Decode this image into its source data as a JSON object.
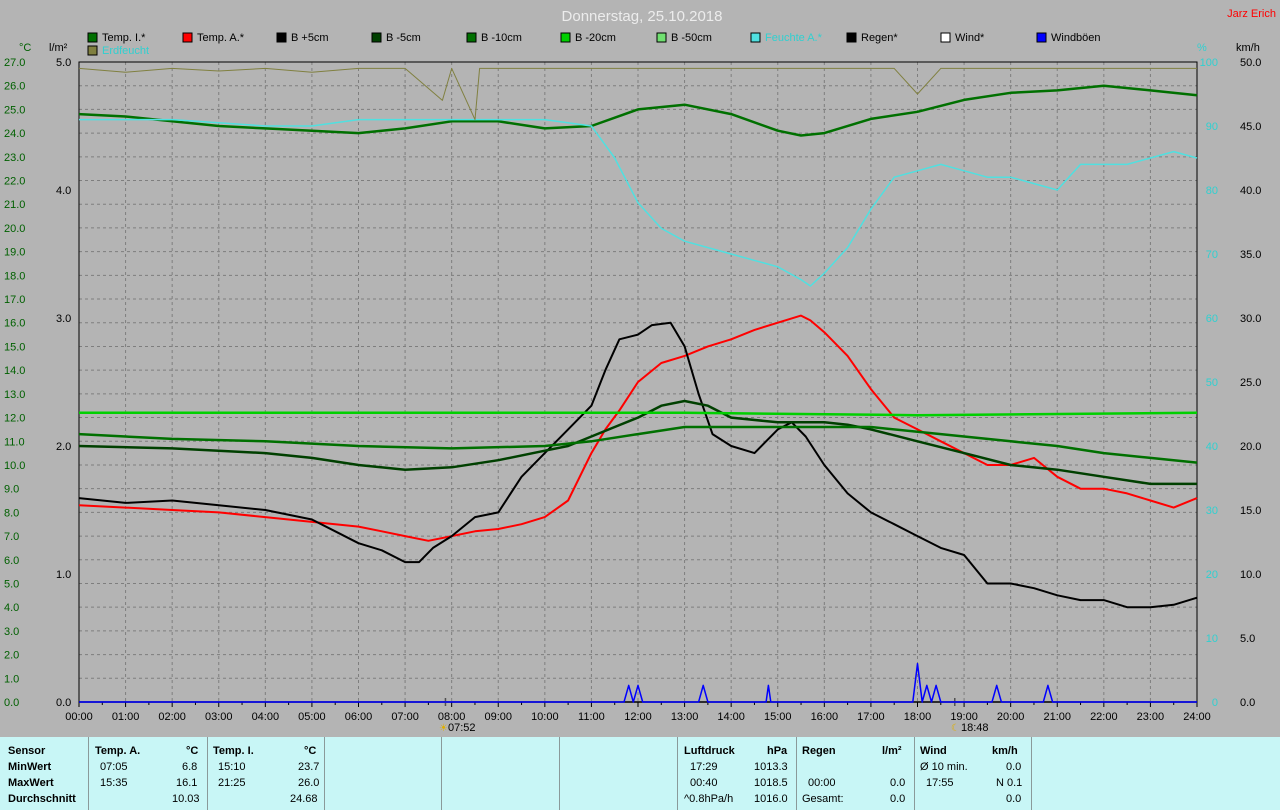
{
  "chart_data": {
    "type": "line",
    "title": "Donnerstag, 25.10.2018",
    "author": "Jarz Erich",
    "x_ticks": [
      "00:00",
      "01:00",
      "02:00",
      "03:00",
      "04:00",
      "05:00",
      "06:00",
      "07:00",
      "08:00",
      "09:00",
      "10:00",
      "11:00",
      "12:00",
      "13:00",
      "14:00",
      "15:00",
      "16:00",
      "17:00",
      "18:00",
      "19:00",
      "20:00",
      "21:00",
      "22:00",
      "23:00",
      "24:00"
    ],
    "axes": {
      "temp": {
        "unit": "°C",
        "range": [
          0,
          27
        ],
        "ticks": [
          0.0,
          1.0,
          2.0,
          3.0,
          4.0,
          5.0,
          6.0,
          7.0,
          8.0,
          9.0,
          10.0,
          11.0,
          12.0,
          13.0,
          14.0,
          15.0,
          16.0,
          17.0,
          18.0,
          19.0,
          20.0,
          21.0,
          22.0,
          23.0,
          24.0,
          25.0,
          26.0,
          27.0
        ]
      },
      "rain": {
        "unit": "l/m²",
        "range": [
          0,
          5
        ],
        "ticks": [
          0.0,
          1.0,
          2.0,
          3.0,
          4.0,
          5.0
        ]
      },
      "humidity": {
        "unit": "%",
        "range": [
          0,
          100
        ],
        "ticks": [
          0,
          10,
          20,
          30,
          40,
          50,
          60,
          70,
          80,
          90,
          100
        ]
      },
      "wind": {
        "unit": "km/h",
        "range": [
          0,
          50
        ],
        "ticks": [
          0.0,
          5.0,
          10.0,
          15.0,
          20.0,
          25.0,
          30.0,
          35.0,
          40.0,
          45.0,
          50.0
        ]
      }
    },
    "legend": [
      {
        "name": "Temp. I.*",
        "color": "#007000"
      },
      {
        "name": "Temp. A.*",
        "color": "#ff0000"
      },
      {
        "name": "B +5cm",
        "color": "#000000"
      },
      {
        "name": "B -5cm",
        "color": "#004000"
      },
      {
        "name": "B -10cm",
        "color": "#007000"
      },
      {
        "name": "B -20cm",
        "color": "#00d000"
      },
      {
        "name": "B -50cm",
        "color": "#70e070"
      },
      {
        "name": "Feuchte A.*",
        "color": "#50e0e0"
      },
      {
        "name": "Regen*",
        "color": "#000000"
      },
      {
        "name": "Wind*",
        "color": "#ffffff"
      },
      {
        "name": "Windböen",
        "color": "#0000ff"
      },
      {
        "name": "Erdfeucht",
        "color": "#808040"
      }
    ],
    "sunrise": "07:52",
    "sunset": "18:48",
    "series": [
      {
        "name": "Temp. I.*",
        "axis": "temp",
        "color": "#007000",
        "x": [
          0,
          1,
          2,
          3,
          4,
          5,
          6,
          6.5,
          7,
          8,
          9,
          10,
          11,
          12,
          13,
          14,
          15,
          15.5,
          16,
          17,
          18,
          19,
          20,
          21,
          22,
          23,
          24
        ],
        "y": [
          24.8,
          24.7,
          24.5,
          24.3,
          24.2,
          24.1,
          24.0,
          24.1,
          24.2,
          24.5,
          24.5,
          24.2,
          24.3,
          25.0,
          25.2,
          24.8,
          24.1,
          23.9,
          24.0,
          24.6,
          24.9,
          25.4,
          25.7,
          25.8,
          26.0,
          25.8,
          25.6
        ]
      },
      {
        "name": "Temp. A.*",
        "axis": "temp",
        "color": "#ff0000",
        "x": [
          0,
          1,
          2,
          3,
          4,
          5,
          6,
          6.5,
          7,
          7.5,
          8,
          8.5,
          9,
          9.5,
          10,
          10.5,
          11,
          11.3,
          11.6,
          12,
          12.5,
          13,
          13.5,
          14,
          14.5,
          15,
          15.5,
          15.7,
          16,
          16.5,
          17,
          17.5,
          18,
          18.5,
          19,
          19.5,
          20,
          20.5,
          21,
          21.5,
          22,
          22.5,
          23,
          23.5,
          24
        ],
        "y": [
          8.3,
          8.2,
          8.1,
          8.0,
          7.8,
          7.6,
          7.4,
          7.2,
          7.0,
          6.8,
          7.0,
          7.2,
          7.3,
          7.5,
          7.8,
          8.5,
          10.5,
          11.5,
          12.3,
          13.5,
          14.3,
          14.6,
          15.0,
          15.3,
          15.7,
          16.0,
          16.3,
          16.1,
          15.6,
          14.6,
          13.2,
          12.0,
          11.5,
          11.0,
          10.5,
          10.0,
          10.0,
          10.3,
          9.5,
          9.0,
          9.0,
          8.8,
          8.5,
          8.2,
          8.6
        ]
      },
      {
        "name": "B +5cm",
        "axis": "temp",
        "color": "#000000",
        "x": [
          0,
          0.5,
          1,
          2,
          3,
          4,
          5,
          5.5,
          6,
          6.5,
          7,
          7.3,
          7.6,
          8,
          8.5,
          9,
          9.5,
          10,
          10.5,
          11,
          11.3,
          11.6,
          12,
          12.3,
          12.7,
          13,
          13.3,
          13.6,
          14,
          14.5,
          15,
          15.3,
          15.6,
          16,
          16.5,
          17,
          17.5,
          18,
          18.5,
          19,
          19.5,
          20,
          20.5,
          21,
          21.5,
          22,
          22.5,
          23,
          23.5,
          24
        ],
        "y": [
          8.6,
          8.5,
          8.4,
          8.5,
          8.3,
          8.1,
          7.7,
          7.2,
          6.7,
          6.4,
          5.9,
          5.9,
          6.5,
          7.0,
          7.8,
          8.0,
          9.5,
          10.5,
          11.5,
          12.5,
          14.0,
          15.3,
          15.5,
          15.9,
          16.0,
          15.0,
          13.0,
          11.3,
          10.8,
          10.5,
          11.5,
          11.8,
          11.2,
          10.0,
          8.8,
          8.0,
          7.5,
          7.0,
          6.5,
          6.2,
          5.0,
          5.0,
          4.8,
          4.5,
          4.3,
          4.3,
          4.0,
          4.0,
          4.1,
          4.4
        ]
      },
      {
        "name": "B -5cm",
        "axis": "temp",
        "color": "#004000",
        "x": [
          0,
          2,
          4,
          5,
          6,
          7,
          8,
          9,
          10,
          10.5,
          11,
          11.5,
          12,
          12.5,
          13,
          13.5,
          14,
          15,
          15.5,
          16,
          16.5,
          17,
          18,
          19,
          20,
          21,
          22,
          23,
          24
        ],
        "y": [
          10.8,
          10.7,
          10.5,
          10.3,
          10.0,
          9.8,
          9.9,
          10.2,
          10.6,
          10.8,
          11.2,
          11.6,
          12.0,
          12.5,
          12.7,
          12.5,
          12.0,
          11.8,
          11.8,
          11.8,
          11.7,
          11.5,
          11.0,
          10.5,
          10.0,
          9.8,
          9.5,
          9.2,
          9.2
        ]
      },
      {
        "name": "B -10cm",
        "axis": "temp",
        "color": "#007000",
        "x": [
          0,
          2,
          4,
          6,
          8,
          10,
          11,
          12,
          13,
          14,
          15,
          16,
          17,
          18,
          19,
          20,
          21,
          22,
          23,
          24
        ],
        "y": [
          11.3,
          11.1,
          11.0,
          10.8,
          10.7,
          10.8,
          11.0,
          11.3,
          11.6,
          11.6,
          11.6,
          11.6,
          11.6,
          11.4,
          11.2,
          11.0,
          10.8,
          10.5,
          10.3,
          10.1
        ]
      },
      {
        "name": "B -20cm",
        "axis": "temp",
        "color": "#00d000",
        "x": [
          0,
          6,
          12,
          13,
          18,
          24
        ],
        "y": [
          12.2,
          12.2,
          12.2,
          12.2,
          12.1,
          12.2
        ]
      },
      {
        "name": "Feuchte A.*",
        "axis": "humidity",
        "color": "#50e0e0",
        "x": [
          0,
          2,
          4,
          5,
          6,
          8,
          9,
          10,
          11,
          11.5,
          12,
          12.5,
          13,
          14,
          15,
          15.5,
          15.7,
          16,
          16.5,
          17,
          17.5,
          18,
          18.5,
          19,
          19.5,
          20,
          20.5,
          21,
          21.5,
          22,
          22.5,
          23,
          23.5,
          24
        ],
        "y": [
          91,
          91,
          90,
          90,
          91,
          91,
          91,
          91,
          90,
          85,
          78,
          74,
          72,
          70,
          68,
          66,
          65,
          67,
          71,
          77,
          82,
          83,
          84,
          83,
          82,
          82,
          81,
          80,
          84,
          84,
          84,
          85,
          86,
          85
        ]
      },
      {
        "name": "Erdfeucht",
        "axis": "rain",
        "color": "#808040",
        "x": [
          0,
          1,
          2,
          3,
          4,
          5,
          6,
          7,
          7.8,
          8,
          8.5,
          8.6,
          9,
          10,
          11,
          12,
          13,
          14,
          15,
          16,
          17,
          17.5,
          18,
          18.5,
          19,
          20,
          21,
          22,
          23,
          24
        ],
        "y": [
          4.95,
          4.92,
          4.95,
          4.93,
          4.95,
          4.92,
          4.95,
          4.95,
          4.7,
          4.95,
          4.55,
          4.95,
          4.95,
          4.95,
          4.95,
          4.95,
          4.95,
          4.95,
          4.95,
          4.95,
          4.95,
          4.95,
          4.75,
          4.95,
          4.95,
          4.95,
          4.95,
          4.95,
          4.95,
          4.95
        ]
      },
      {
        "name": "Windböen",
        "axis": "wind",
        "color": "#0000ff",
        "x": [
          0,
          11.7,
          11.8,
          11.9,
          12.0,
          12.1,
          13.3,
          13.4,
          13.5,
          14.75,
          14.8,
          14.85,
          17.9,
          18.0,
          18.1,
          18.2,
          18.3,
          18.4,
          18.5,
          18.6,
          19.6,
          19.7,
          19.8,
          20.7,
          20.8,
          20.9,
          24
        ],
        "y": [
          0,
          0,
          1.3,
          0,
          1.3,
          0,
          0,
          1.3,
          0,
          0,
          1.3,
          0,
          0,
          3.0,
          0,
          1.3,
          0,
          1.3,
          0,
          0,
          0,
          1.3,
          0,
          0,
          1.3,
          0,
          0
        ]
      }
    ]
  },
  "footer": {
    "header": {
      "sensor": "Sensor",
      "tempa": "Temp. A.",
      "tempa_unit": "°C",
      "tempi": "Temp. I.",
      "tempi_unit": "°C",
      "luft": "Luftdruck",
      "luft_unit": "hPa",
      "regen": "Regen",
      "regen_unit": "l/m²",
      "wind": "Wind",
      "wind_unit": "km/h"
    },
    "min": {
      "label": "MinWert",
      "tempa_time": "07:05",
      "tempa_val": "6.8",
      "tempi_time": "15:10",
      "tempi_val": "23.7",
      "luft_time": "17:29",
      "luft_val": "1013.3",
      "wind_label": "Ø 10 min.",
      "wind_val": "0.0"
    },
    "max": {
      "label": "MaxWert",
      "tempa_time": "15:35",
      "tempa_val": "16.1",
      "tempi_time": "21:25",
      "tempi_val": "26.0",
      "luft_time": "00:40",
      "luft_val": "1018.5",
      "regen_time": "00:00",
      "regen_val": "0.0",
      "wind_time": "17:55",
      "wind_val": "N 0.1"
    },
    "avg": {
      "label": "Durchschnitt",
      "tempa_val": "10.03",
      "tempi_val": "24.68",
      "luft_time": "^0.8hPa/h",
      "luft_val": "1016.0",
      "regen_label": "Gesamt:",
      "regen_val": "0.0",
      "wind_val": "0.0"
    }
  }
}
